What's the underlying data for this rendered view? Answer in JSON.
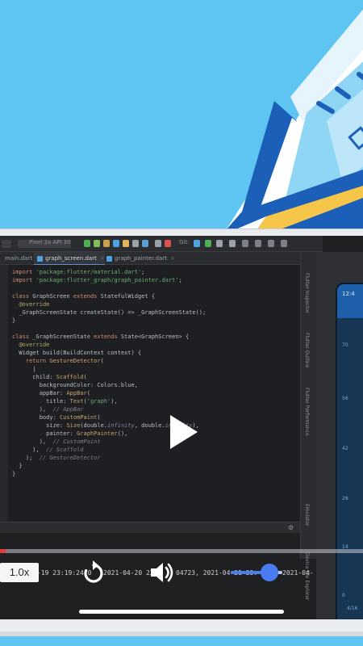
{
  "colors": {
    "sky": "#5ec4f2",
    "ide_background": "#1e1f22",
    "progress_played": "#e53935",
    "volume_accent": "#4a7cf0",
    "phone_frame": "#e9ebee"
  },
  "ide": {
    "toolbar": {
      "device": "Pixel 3a API 30",
      "git_label": "Git:"
    },
    "tabs": [
      {
        "label": "main.dart"
      },
      {
        "label": "graph_screen.dart"
      },
      {
        "label": "graph_painter.dart"
      }
    ],
    "code_lines": [
      "import 'package:flutter/material.dart';",
      "import 'package:flutter_graph/graph_painter.dart';",
      "",
      "class GraphScreen extends StatefulWidget {",
      "  @override",
      "  _GraphScreenState createState() => _GraphScreenState();",
      "}",
      "",
      "class _GraphScreenState extends State<GraphScreen> {",
      "  @override",
      "  Widget build(BuildContext context) {",
      "    return GestureDetector(",
      "      |",
      "      child: Scaffold(",
      "        backgroundColor: Colors.blue,",
      "        appBar: AppBar(",
      "          title: Text('graph'),",
      "        ),  // AppBar",
      "        body: CustomPaint(",
      "          size: Size(double.infinity, double.infinity),",
      "          painter: GraphPainter(),",
      "        ),  // CustomPaint",
      "      ),  // Scaffold",
      "    );  // GestureDetector",
      "  }",
      "}"
    ],
    "side_panels": [
      "Flutter Inspector",
      "Flutter Outline",
      "Flutter Performance",
      "Emulator",
      "Device File Explorer"
    ]
  },
  "emulator": {
    "time": "12:4",
    "y_ticks": [
      "70",
      "56",
      "42",
      "28",
      "14",
      "0"
    ],
    "x_label": "4/16"
  },
  "video": {
    "progress": 0.016,
    "speed_label": "1.0x",
    "timeline_labels": [
      "-19 23:19:24.0",
      "2021-04-20 23:",
      "04723, 2021-04-21 23:",
      "2021-04-"
    ],
    "volume_level": 0.75,
    "state": "paused",
    "icons": {
      "play": "play-icon",
      "replay": "replay-icon",
      "volume": "volume-icon"
    }
  }
}
